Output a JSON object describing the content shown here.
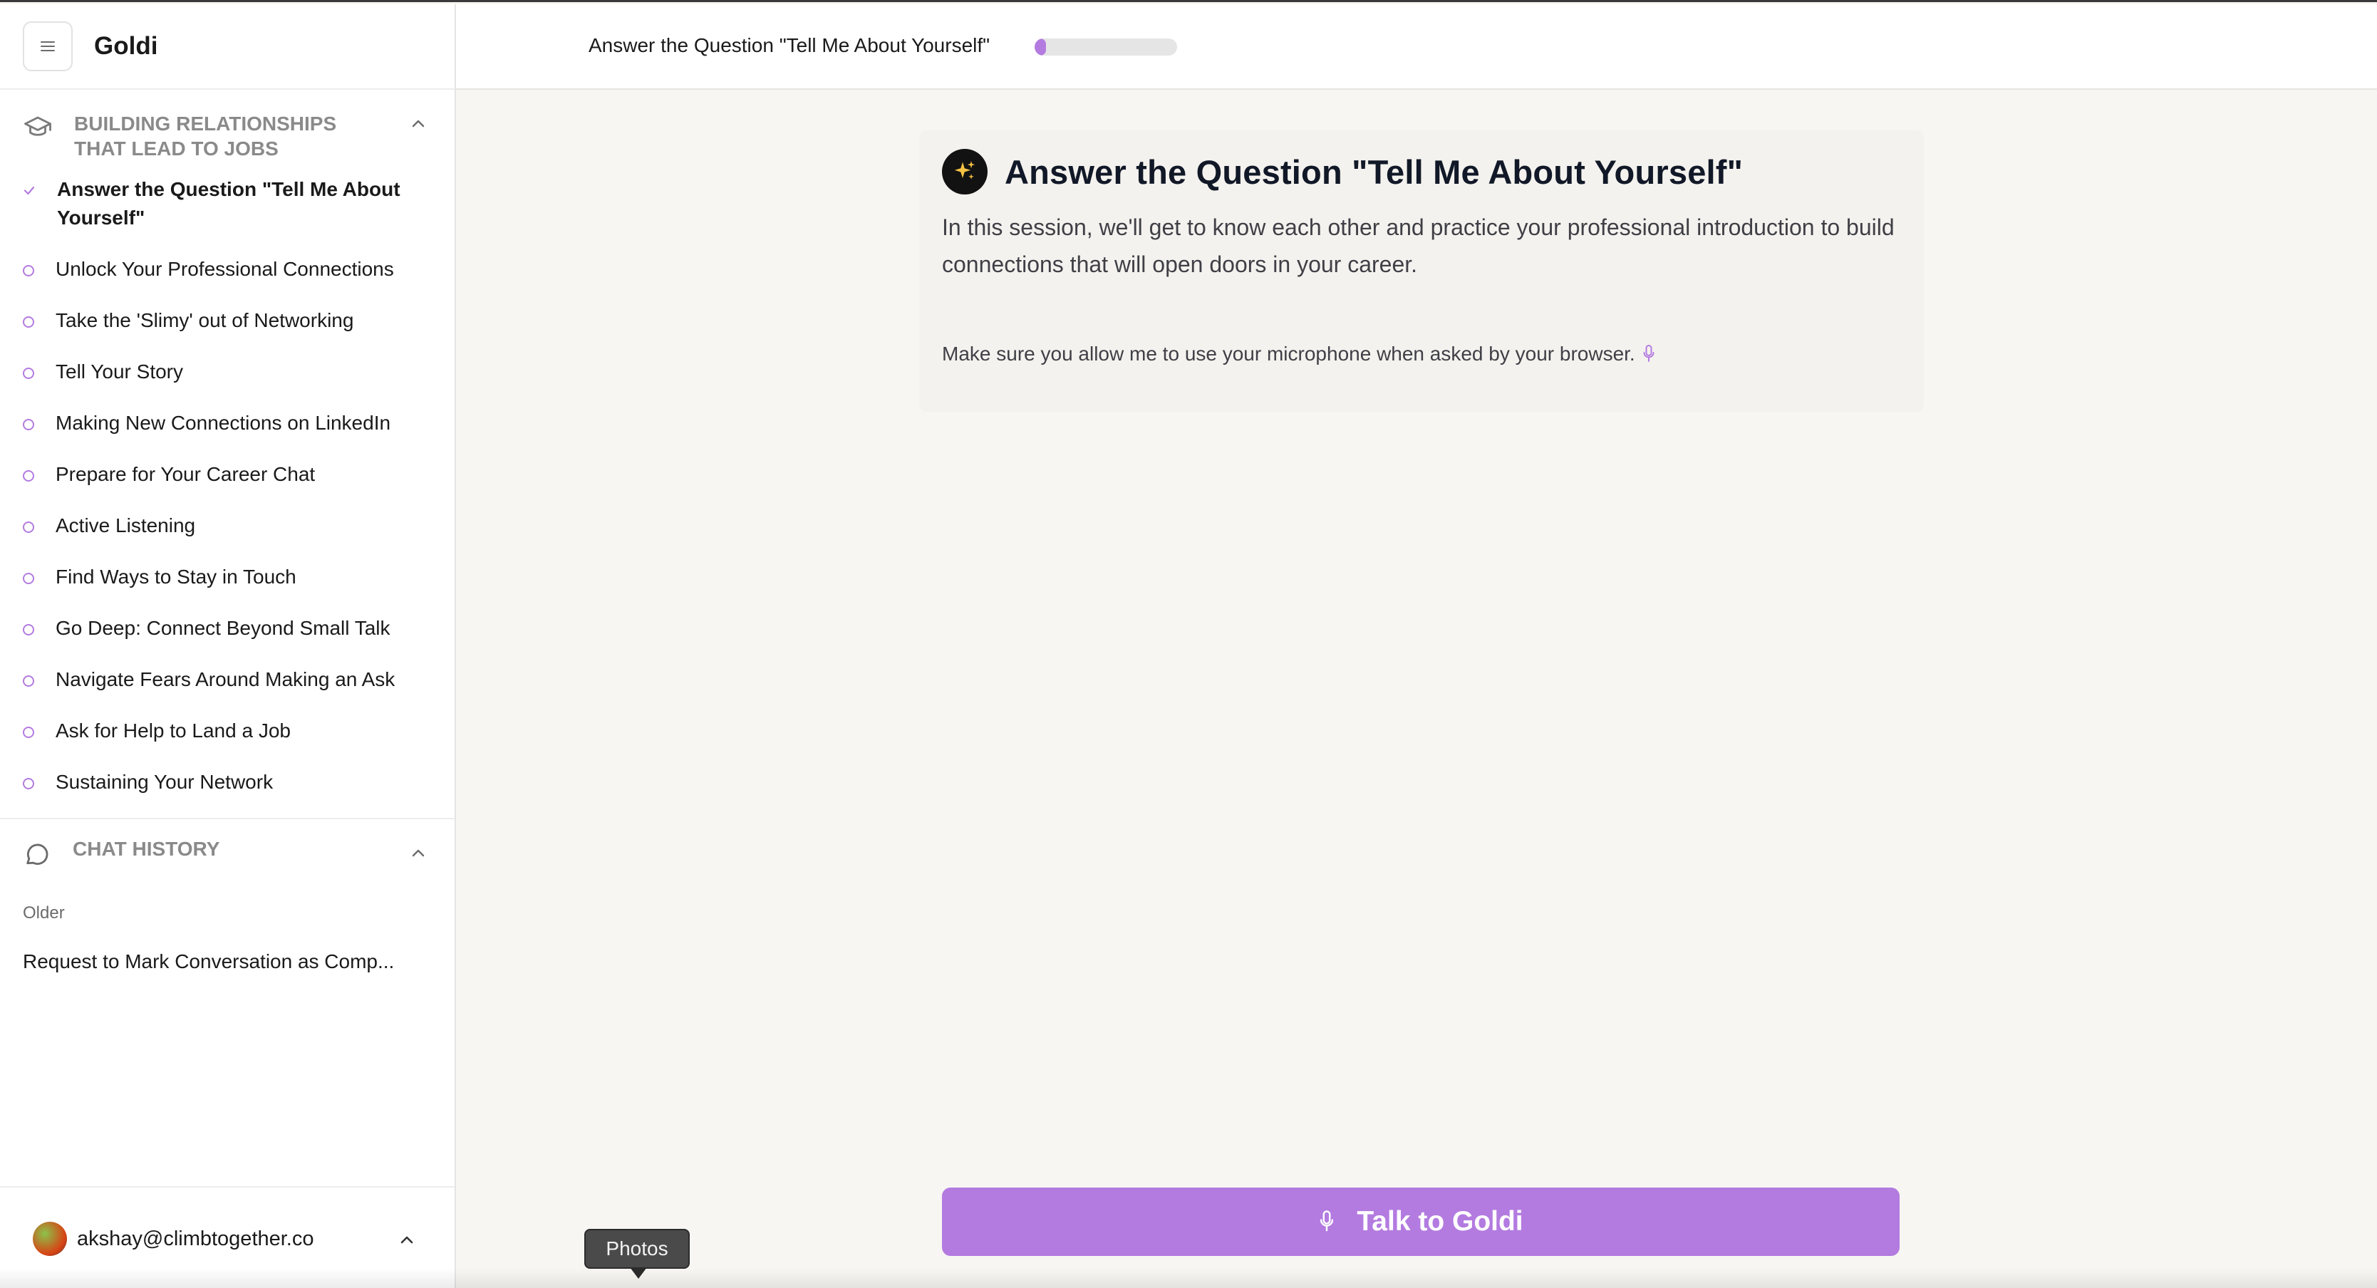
{
  "sidebar": {
    "app_title": "Goldi",
    "course": {
      "title": "BUILDING RELATIONSHIPS THAT LEAD TO JOBS",
      "lessons": [
        {
          "label": "Answer the Question \"Tell Me About Yourself\"",
          "status": "completed"
        },
        {
          "label": "Unlock Your Professional Connections",
          "status": "pending"
        },
        {
          "label": "Take the 'Slimy' out of Networking",
          "status": "pending"
        },
        {
          "label": "Tell Your Story",
          "status": "pending"
        },
        {
          "label": "Making New Connections on LinkedIn",
          "status": "pending"
        },
        {
          "label": "Prepare for Your Career Chat",
          "status": "pending"
        },
        {
          "label": "Active Listening",
          "status": "pending"
        },
        {
          "label": "Find Ways to Stay in Touch",
          "status": "pending"
        },
        {
          "label": "Go Deep: Connect Beyond Small Talk",
          "status": "pending"
        },
        {
          "label": "Navigate Fears Around Making an Ask",
          "status": "pending"
        },
        {
          "label": "Ask for Help to Land a Job",
          "status": "pending"
        },
        {
          "label": "Sustaining Your Network",
          "status": "pending"
        }
      ]
    },
    "chat_history": {
      "title": "CHAT HISTORY",
      "group_label": "Older",
      "items": [
        "Request to Mark Conversation as Comp..."
      ]
    },
    "user": {
      "email": "akshay@climbtogether.co"
    }
  },
  "topbar": {
    "session_title": "Answer the Question \"Tell Me About Yourself\"",
    "progress": 0.08
  },
  "main": {
    "title": "Answer the Question \"Tell Me About Yourself\"",
    "description": "In this session, we'll get to know each other and practice your professional introduction to build connections that will open doors in your career.",
    "mic_note": "Make sure you allow me to use your microphone when asked by your browser.",
    "talk_button": "Talk to Goldi"
  },
  "tooltip": {
    "label": "Photos"
  },
  "colors": {
    "accent": "#b37be0",
    "badge": "#121212"
  }
}
